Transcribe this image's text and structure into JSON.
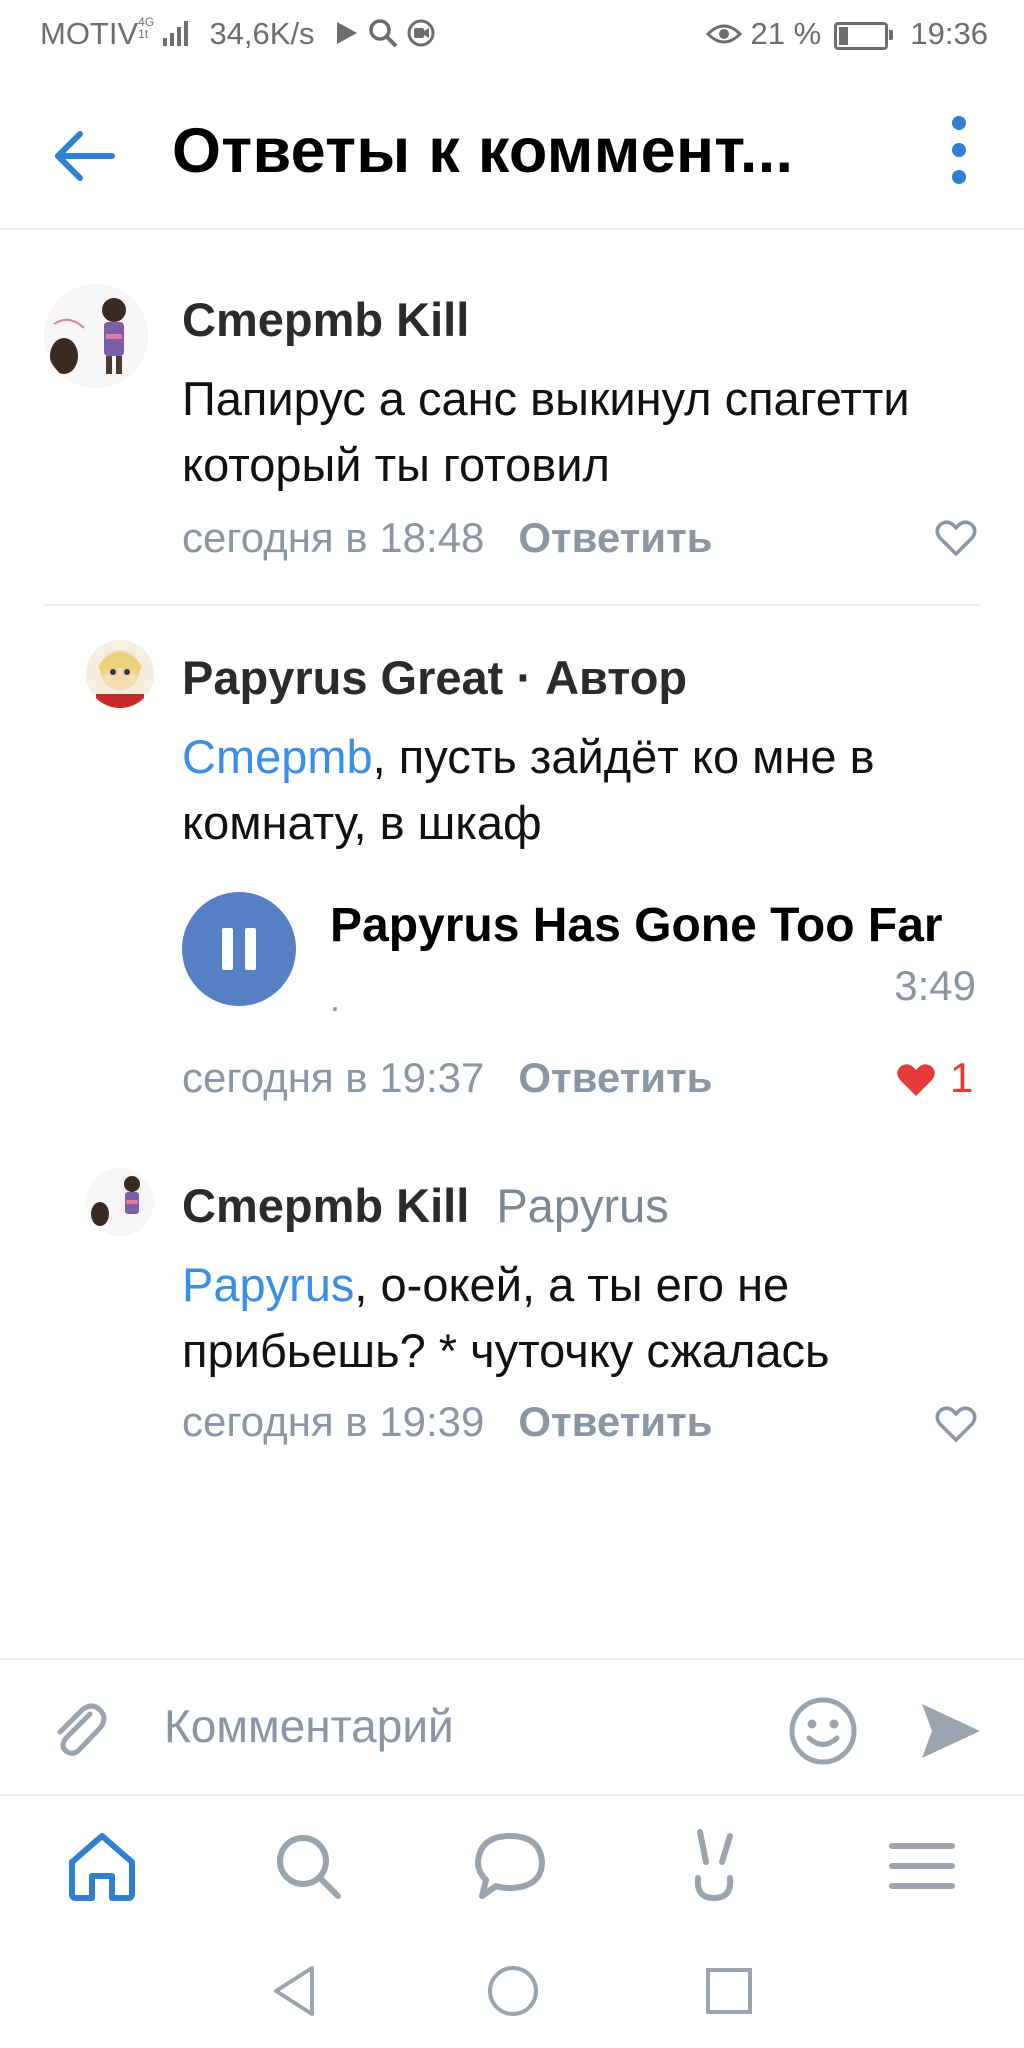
{
  "status_bar": {
    "carrier": "MOTIV",
    "network_top": "4G",
    "network_bottom": "1t",
    "speed": "34,6K/s",
    "battery_percent": "21 %",
    "battery_level": 0.21,
    "time": "19:36"
  },
  "header": {
    "title": "Ответы к коммент..."
  },
  "comments": [
    {
      "author": "Cmepmb Kill",
      "text": "Папирус а санс выкинул спагетти который ты готовил",
      "time": "сегодня в 18:48",
      "reply_label": "Ответить",
      "liked": false
    },
    {
      "author": "Papyrus Great",
      "author_separator": "·",
      "author_badge": "Автор",
      "mention": "Cmepmb",
      "text": ", пусть зайдёт ко мне в комнату, в шкаф",
      "audio": {
        "title": "Papyrus Has Gone Too Far",
        "artist": ".",
        "duration": "3:49"
      },
      "time": "сегодня в 19:37",
      "reply_label": "Ответить",
      "liked": true,
      "likes": "1"
    },
    {
      "author": "Cmepmb Kill",
      "reply_to": "Papyrus",
      "mention": "Papyrus",
      "text": ", о-окей, а ты его не прибьешь? * чуточку сжалась",
      "time": "сегодня в 19:39",
      "reply_label": "Ответить",
      "liked": false
    }
  ],
  "composer": {
    "placeholder": "Комментарий"
  },
  "colors": {
    "accent": "#2f80d1",
    "mention": "#3b8ee8",
    "meta": "#8a96a3",
    "like": "#e63a3a",
    "audio_button": "#5580c4"
  },
  "icons": {
    "header": [
      "back-arrow-icon",
      "more-vertical-icon"
    ],
    "composer": [
      "paperclip-icon",
      "smiley-icon",
      "send-icon"
    ],
    "tabbar": [
      "home-icon",
      "search-icon",
      "chat-bubble-icon",
      "bunny-icon",
      "menu-lines-icon"
    ],
    "system_nav": [
      "back-triangle-icon",
      "home-circle-icon",
      "recents-square-icon"
    ]
  }
}
